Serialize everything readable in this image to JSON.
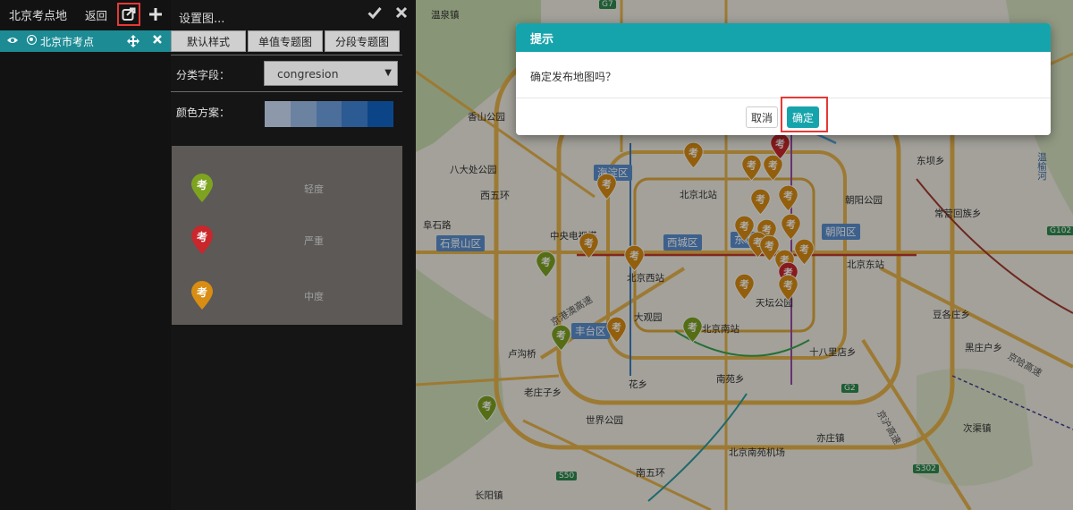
{
  "left_panel": {
    "title": "北京考点地",
    "back": "返回",
    "layer": "北京市考点"
  },
  "settings": {
    "title": "设置图...",
    "tabs": [
      "默认样式",
      "单值专题图",
      "分段专题图"
    ],
    "field_label": "分类字段：",
    "field_value": "congresion",
    "color_label": "颜色方案：",
    "color_ramp": [
      "#8d99ab",
      "#6b82a1",
      "#4b6e9a",
      "#2c5a92",
      "#0b4588"
    ],
    "legend": [
      {
        "label": "轻度",
        "pin_text": "考",
        "color": "#7ea320"
      },
      {
        "label": "严重",
        "pin_text": "考",
        "color": "#c9272b"
      },
      {
        "label": "中度",
        "pin_text": "考",
        "color": "#d98d12"
      }
    ]
  },
  "map": {
    "labels": [
      "温泉镇",
      "香山公园",
      "八大处公园",
      "西五环",
      "阜石路",
      "中央电视塔",
      "北京北站",
      "朝阳公园",
      "常营回族乡",
      "东坝乡",
      "北京东站",
      "北京西站",
      "天坛公园",
      "大观园",
      "北京南站",
      "十八里店乡",
      "卢沟桥",
      "老庄子乡",
      "花乡",
      "南苑乡",
      "世界公园",
      "北京南苑机场",
      "亦庄镇",
      "次渠镇",
      "黑庄户乡",
      "豆各庄乡",
      "南五环",
      "长阳镇",
      "京港澳高速",
      "京哈高速",
      "京沪高速",
      "温榆河"
    ],
    "districts": [
      "海淀区",
      "石景山区",
      "西城区",
      "东城区",
      "朝阳区",
      "丰台区"
    ],
    "road_badges": [
      "G7",
      "G102",
      "G2",
      "S50",
      "S302"
    ],
    "marker_text": "考"
  },
  "dialog": {
    "title": "提示",
    "message": "确定发布地图吗？",
    "cancel": "取消",
    "ok": "确定"
  }
}
